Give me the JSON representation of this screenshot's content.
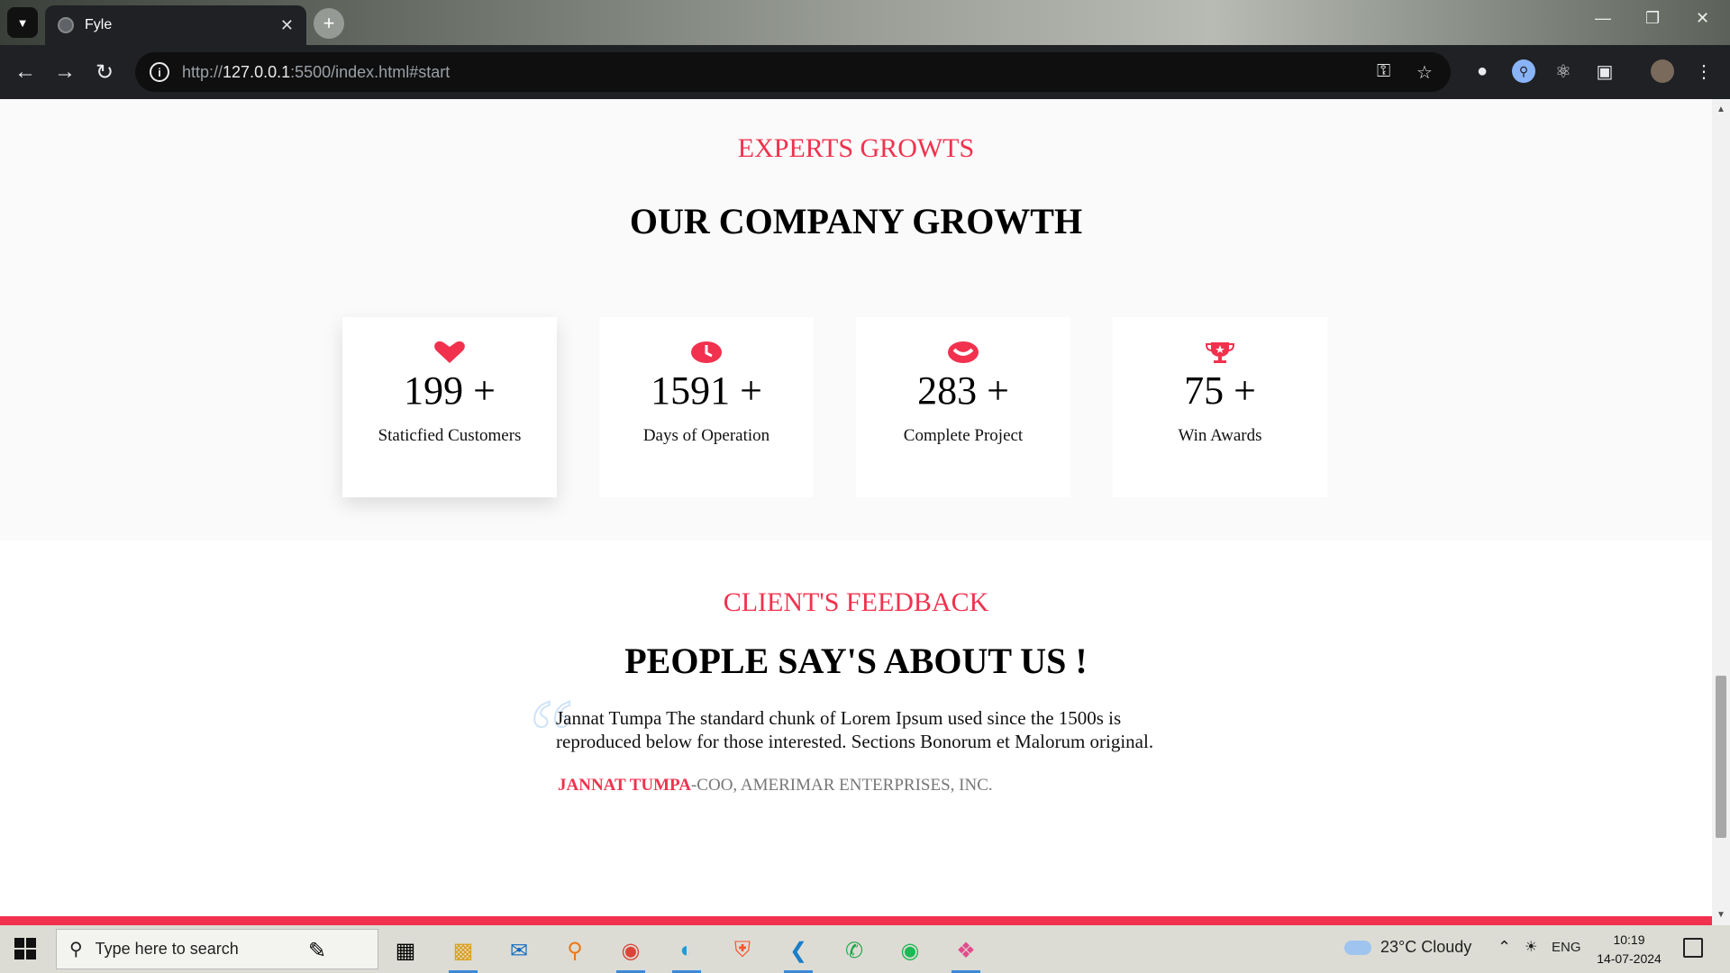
{
  "browser": {
    "tab_title": "Fyle",
    "url_scheme": "http://",
    "url_host": "127.0.0.1",
    "url_rest": ":5500/index.html#start"
  },
  "growth": {
    "eyebrow": "EXPERTS GROWTS",
    "heading": "OUR COMPANY GROWTH",
    "stats": [
      {
        "icon": "heart-icon",
        "value": "199 +",
        "label": "Staticfied Customers"
      },
      {
        "icon": "clock-icon",
        "value": "1591 +",
        "label": "Days of Operation"
      },
      {
        "icon": "smile-icon",
        "value": "283 +",
        "label": "Complete Project"
      },
      {
        "icon": "trophy-icon",
        "value": "75 +",
        "label": "Win Awards"
      }
    ]
  },
  "feedback": {
    "eyebrow": "CLIENT'S FEEDBACK",
    "heading": "PEOPLE SAY'S ABOUT US !",
    "quote_glyph": "“",
    "text": "Jannat Tumpa The standard chunk of Lorem Ipsum used since the 1500s is reproduced below for those interested. Sections Bonorum et Malorum original.",
    "author_name": "JANNAT TUMPA",
    "author_role": "-COO, AMERIMAR ENTERPRISES, INC."
  },
  "taskbar": {
    "search_placeholder": "Type here to search",
    "weather": "23°C  Cloudy",
    "language": "ENG",
    "time": "10:19",
    "date": "14-07-2024"
  },
  "colors": {
    "accent": "#f1314e"
  }
}
